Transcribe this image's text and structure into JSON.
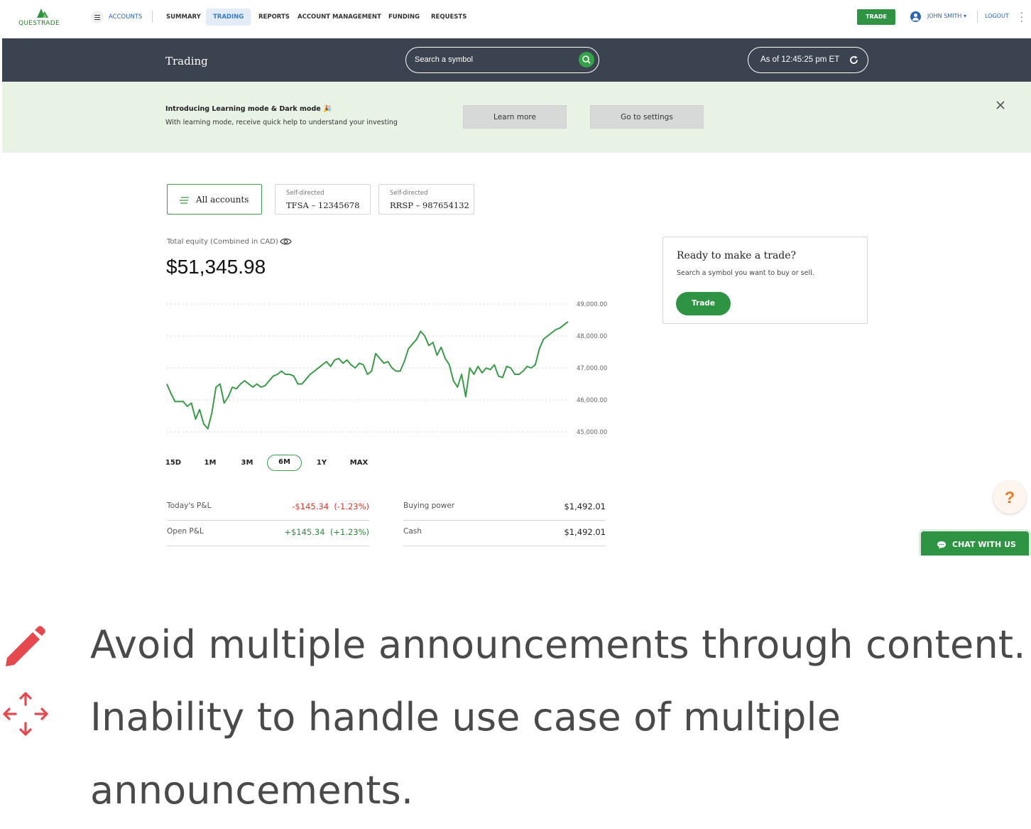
{
  "colors": {
    "brand_green": "#2e9444",
    "nav_blue": "#2e64b5",
    "header_dark": "#3b4351",
    "banner_bg": "#e8f3e6",
    "negative": "#d33a2c",
    "positive": "#2e8b3f",
    "bullet_icon": "#e5484d"
  },
  "logo": {
    "text": "QUESTRADE"
  },
  "nav": {
    "menu_label": "ACCOUNTS",
    "items": [
      "SUMMARY",
      "TRADING",
      "REPORTS",
      "ACCOUNT MANAGEMENT",
      "FUNDING",
      "REQUESTS"
    ],
    "active": "TRADING",
    "trade_button": "TRADE",
    "user": "JOHN SMITH ▾",
    "logout": "LOGOUT"
  },
  "header": {
    "title": "Trading",
    "search_placeholder": "Search a symbol",
    "as_of": "As of 12:45:25 pm ET"
  },
  "banner": {
    "title": "Introducing Learning mode & Dark mode 🎉",
    "text": "With learning mode, receive quick help to understand your investing",
    "learn_more": "Learn more",
    "go_settings": "Go to settings"
  },
  "accounts": {
    "all": "All accounts",
    "items": [
      {
        "type": "Self-directed",
        "number": "TFSA – 12345678"
      },
      {
        "type": "Self-directed",
        "number": "RRSP – 987654132"
      }
    ]
  },
  "equity": {
    "label": "Total equity (Combined in CAD)",
    "value": "$51,345.98"
  },
  "chart_data": {
    "type": "line",
    "ylim": [
      45000,
      49000
    ],
    "yticks": [
      "49,000.00",
      "48,000.00",
      "47,000.00",
      "46,000.00",
      "45,000.00"
    ],
    "yvalues": [
      49000,
      48000,
      47000,
      46000,
      45000
    ],
    "grid": "dotted horizontal",
    "series": [
      {
        "values": [
          46500,
          46200,
          45950,
          45950,
          45950,
          45800,
          45900,
          45400,
          45700,
          45250,
          45100,
          45600,
          46400,
          46500,
          45900,
          46100,
          46400,
          46350,
          46500,
          46600,
          46500,
          46400,
          46500,
          46400,
          46450,
          46600,
          46750,
          46800,
          46900,
          46800,
          46800,
          46750,
          46500,
          46500,
          46650,
          46800,
          46900,
          47000,
          47100,
          47200,
          47050,
          47250,
          47300,
          47150,
          47250,
          47100,
          47000,
          47150,
          47100,
          46800,
          46900,
          47450,
          47300,
          47150,
          47200,
          47000,
          46900,
          46900,
          47200,
          47600,
          47750,
          47900,
          48150,
          48000,
          47700,
          47800,
          47400,
          47650,
          47300,
          47100,
          46600,
          46400,
          46800,
          46100,
          47000,
          46800,
          47050,
          46850,
          47000,
          46950,
          47100,
          46750,
          46700,
          47050,
          47000,
          46800,
          46800,
          46900,
          47050,
          47000,
          47100,
          47600,
          47900,
          48000,
          48100,
          48200,
          48250,
          48350,
          48450
        ]
      }
    ]
  },
  "ranges": {
    "items": [
      "15D",
      "1M",
      "3M",
      "6M",
      "1Y",
      "MAX"
    ],
    "active": "6M"
  },
  "stats": {
    "todays_pl": {
      "label": "Today's P&L",
      "value": "-$145.34",
      "pct": "(-1.23%)"
    },
    "open_pl": {
      "label": "Open P&L",
      "value": "+$145.34",
      "pct": "(+1.23%)"
    },
    "buying_power": {
      "label": "Buying power",
      "value": "$1,492.01"
    },
    "cash": {
      "label": "Cash",
      "value": "$1,492.01"
    }
  },
  "trade_card": {
    "title": "Ready to make a trade?",
    "text": "Search a symbol you want to buy or sell.",
    "button": "Trade"
  },
  "help": {
    "label": "?"
  },
  "chat": {
    "label": "CHAT WITH US"
  },
  "bullets": [
    {
      "icon": "pencil-icon",
      "line1": "Avoid multiple announcements through content."
    },
    {
      "icon": "move-arrows-icon",
      "line1": "Inability to handle use case of multiple",
      "line2": "announcements."
    }
  ]
}
